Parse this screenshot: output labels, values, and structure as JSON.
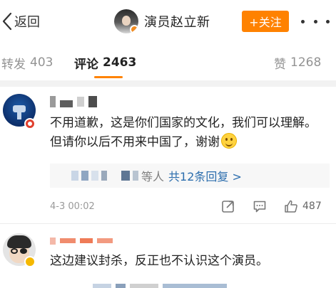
{
  "nav": {
    "back_label": "返回",
    "account_name": "演员赵立新",
    "follow_label": "+关注"
  },
  "tabs": [
    {
      "label": "转发",
      "count": "403",
      "active": false
    },
    {
      "label": "评论",
      "count": "2463",
      "active": true
    },
    {
      "label": "赞",
      "count": "1268",
      "active": false
    }
  ],
  "comments": [
    {
      "text": "不用道歉，这是你们国家的文化，我们可以理解。但请你以后不用来中国了，谢谢",
      "emoji": "smile-emoji",
      "replies": {
        "name_suffix": "等人",
        "link": "共12条回复 >"
      },
      "time": "4-3 00:02",
      "likes": "487"
    },
    {
      "text": "这边建议封杀，反正也不认识这个演员。"
    }
  ],
  "colors": {
    "accent": "#ff8200",
    "link": "#2b6dad",
    "muted": "#939393"
  }
}
